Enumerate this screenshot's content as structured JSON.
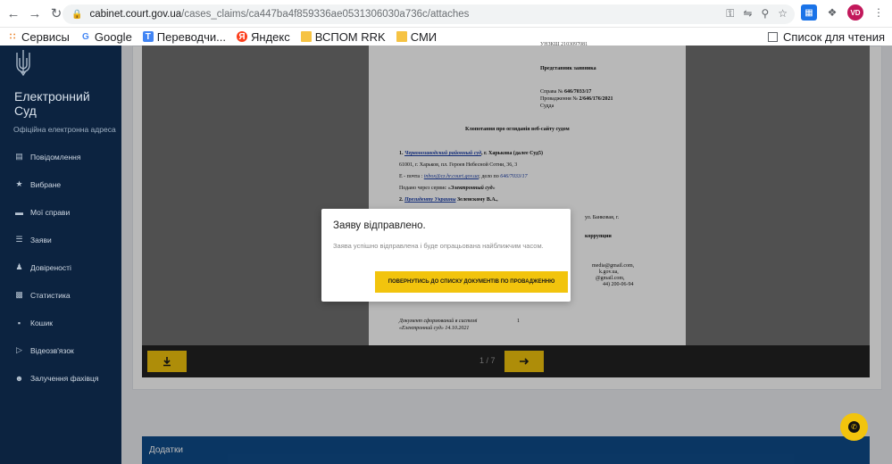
{
  "browser": {
    "url_host": "cabinet.court.gov.ua",
    "url_path": "/cases_claims/ca447ba4f859336ae0531306030a736c/attaches",
    "profile_initials": "VD",
    "bookmarks": [
      "Сервисы",
      "Google",
      "Переводчи...",
      "Яндекс",
      "ВСПОМ RRK",
      "СМИ"
    ],
    "reading_list": "Список для чтения"
  },
  "sidebar": {
    "brand_line1": "Електронний",
    "brand_line2": "Суд",
    "tagline": "Офіційна електронна адреса",
    "items": [
      {
        "label": "Повідомлення",
        "icon": "message-icon"
      },
      {
        "label": "Вибране",
        "icon": "star-icon"
      },
      {
        "label": "Мої справи",
        "icon": "folder-icon"
      },
      {
        "label": "Заяви",
        "icon": "list-icon"
      },
      {
        "label": "Довіреності",
        "icon": "users-icon"
      },
      {
        "label": "Статистика",
        "icon": "chart-icon"
      },
      {
        "label": "Кошик",
        "icon": "trash-icon"
      },
      {
        "label": "Відеозв'язок",
        "icon": "video-icon"
      },
      {
        "label": "Залучення фахівця",
        "icon": "person-add-icon"
      }
    ]
  },
  "document": {
    "line_top": "УНЗКШ 2103097081",
    "rep": "Представник заявника",
    "case_label": "Справа №",
    "case_no": "646/7033/17",
    "proc_label": "Провадження №",
    "proc_no": "2/646/176/2021",
    "court_word": "Судда",
    "heading": "Клопотання про огляданія веб-сайту судом",
    "item1_num": "1.",
    "item1_link": "Червонозаводский районный суд",
    "item1_rest": ", г. Харькова (далее Суд5)",
    "addr": "61001, г. Харьков, пл. Героев Небесной Сотни, 36, 3",
    "email_label": "E - почта :",
    "email": "inbox@cz.hr.court.gov.ua",
    "email_mid": "; дело по",
    "email_case": "646/7033/17",
    "served_label": "Подано через сервис «",
    "served_service": "Электронный суд",
    "served_end": "»",
    "item2_num": "2.",
    "item2_link": "Президенту Украины",
    "item2_rest": "Зеленскому В.А.,",
    "frag1": "ул. Банковая, г.",
    "frag2": "коррупции",
    "frag3": "media@gmail.com,",
    "frag4": "k.gov.ua,",
    "frag5": "@gmail.com,",
    "frag6": "44) 200-06-94",
    "footer1": "Документ сформований в системі",
    "footer_page": "1",
    "footer2": "«Електронний суд» 14.10.2021"
  },
  "viewer": {
    "page_indicator": "1 / 7",
    "download_icon": "download-icon",
    "next_icon": "arrow-right-icon"
  },
  "section_title": "Додатки",
  "modal": {
    "title": "Заяву відправлено.",
    "body": "Заява успішно відправлена і буде опрацьована найближчим часом.",
    "button": "ПОВЕРНУТИСЬ ДО СПИСКУ ДОКУМЕНТІВ ПО ПРОВАДЖЕННЮ"
  },
  "colors": {
    "sidebar_bg": "#0c2340",
    "accent_yellow": "#f2c40d",
    "section_blue": "#0f4c8a"
  }
}
